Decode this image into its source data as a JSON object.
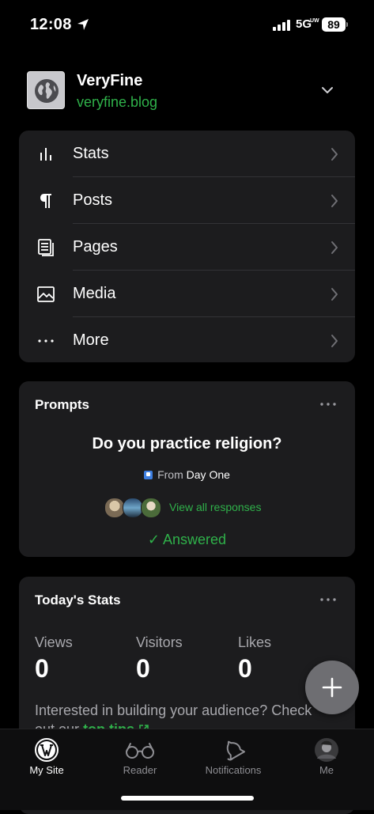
{
  "status_bar": {
    "time": "12:08",
    "network": "5G",
    "network_sub": "UW",
    "battery": "89"
  },
  "site": {
    "name": "VeryFine",
    "url": "veryfine.blog"
  },
  "menu": {
    "items": [
      {
        "label": "Stats",
        "icon": "stats-icon"
      },
      {
        "label": "Posts",
        "icon": "pilcrow-icon"
      },
      {
        "label": "Pages",
        "icon": "pages-icon"
      },
      {
        "label": "Media",
        "icon": "media-icon"
      },
      {
        "label": "More",
        "icon": "more-icon"
      }
    ]
  },
  "prompts": {
    "title": "Prompts",
    "question": "Do you practice religion?",
    "from_prefix": "From",
    "from_name": "Day One",
    "view_all": "View all responses",
    "answered": "✓ Answered"
  },
  "stats": {
    "title": "Today's Stats",
    "labels": [
      "Views",
      "Visitors",
      "Likes"
    ],
    "values": [
      "0",
      "0",
      "0"
    ],
    "note": "Interested in building your audience? Check out our",
    "tips_link": "top tips"
  },
  "tabs": [
    {
      "label": "My Site",
      "active": true
    },
    {
      "label": "Reader",
      "active": false
    },
    {
      "label": "Notifications",
      "active": false
    },
    {
      "label": "Me",
      "active": false
    }
  ],
  "colors": {
    "accent_green": "#2fb14a",
    "card_bg": "#1c1c1e",
    "background": "#000000"
  }
}
